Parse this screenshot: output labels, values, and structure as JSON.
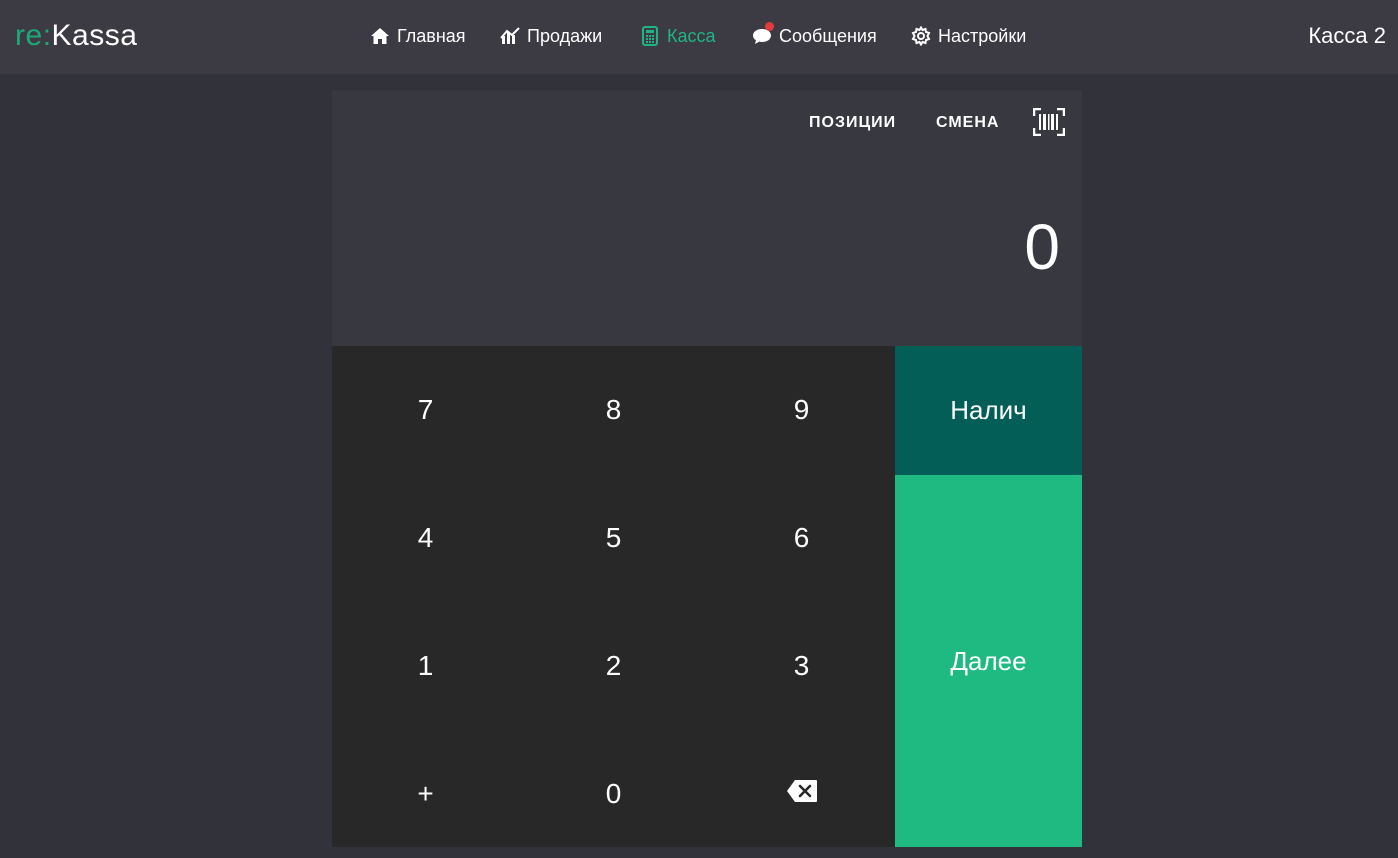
{
  "header": {
    "logo": {
      "re": "re",
      "colon": ":",
      "name": "Kassa"
    },
    "nav": [
      {
        "label": "Главная",
        "icon": "home-icon",
        "active": false
      },
      {
        "label": "Продажи",
        "icon": "sales-chart-icon",
        "active": false
      },
      {
        "label": "Касса",
        "icon": "calculator-icon",
        "active": true
      },
      {
        "label": "Сообщения",
        "icon": "chat-icon",
        "active": false,
        "has_badge": true
      },
      {
        "label": "Настройки",
        "icon": "gear-icon",
        "active": false
      }
    ],
    "cashier_label": "Касса 2"
  },
  "panel": {
    "positions_label": "ПОЗИЦИИ",
    "shift_label": "СМЕНА",
    "barcode_icon": "barcode-scan-icon",
    "display_value": "0"
  },
  "keypad": {
    "keys": [
      "7",
      "8",
      "9",
      "4",
      "5",
      "6",
      "1",
      "2",
      "3",
      "+",
      "0"
    ],
    "backspace_icon": "backspace-icon"
  },
  "actions": {
    "cash_label": "Налич",
    "next_label": "Далее"
  },
  "colors": {
    "accent": "#1fba82",
    "cash_button": "#045e58",
    "badge": "#e23b3b",
    "topbar": "#3c3b44",
    "background": "#32323b",
    "keypad": "#282828"
  }
}
